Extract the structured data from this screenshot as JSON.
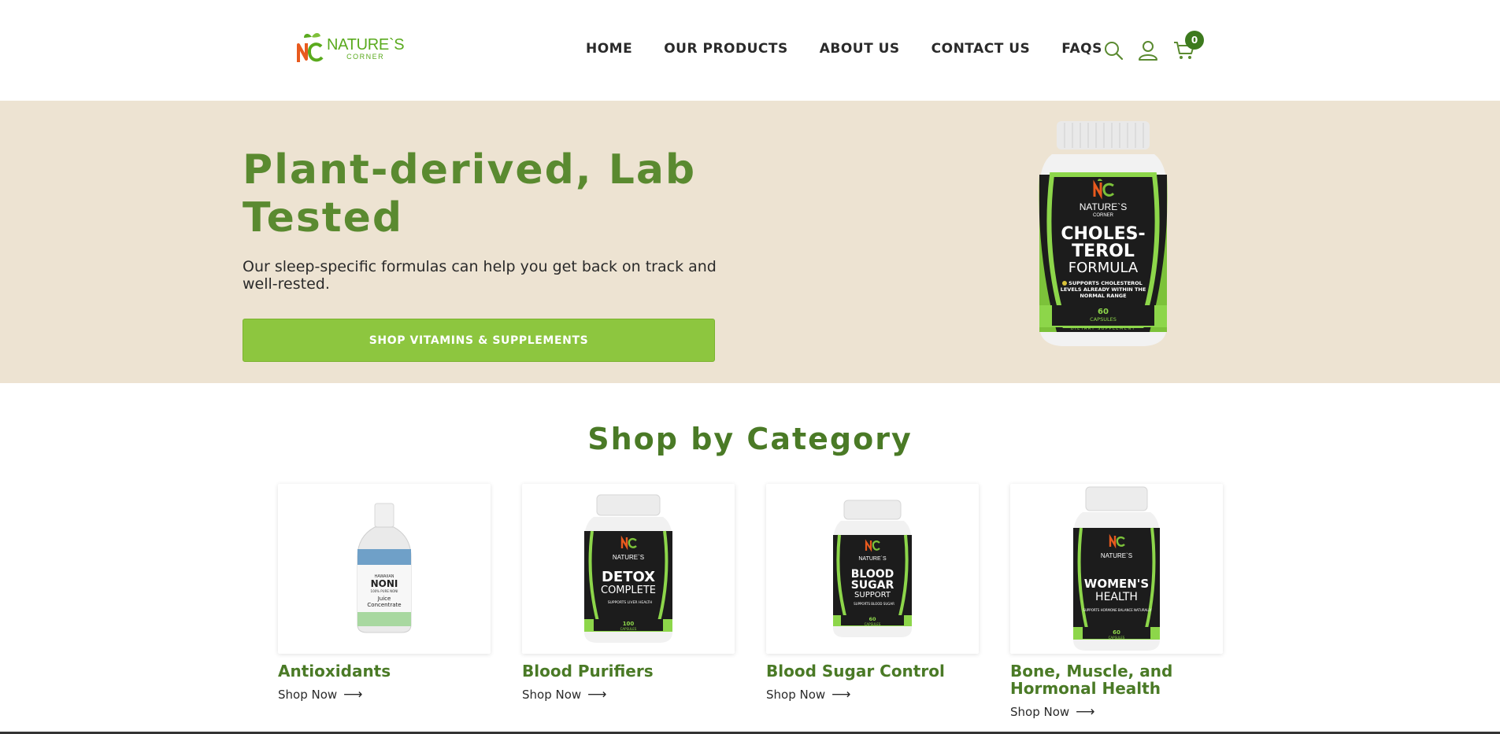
{
  "brand": {
    "name": "NATURE`S",
    "sub": "CORNER",
    "mark": "NC"
  },
  "nav": {
    "items": [
      {
        "label": "HOME"
      },
      {
        "label": "OUR PRODUCTS"
      },
      {
        "label": "ABOUT US"
      },
      {
        "label": "CONTACT US"
      },
      {
        "label": "FAQS"
      }
    ],
    "cart_count": "0"
  },
  "hero": {
    "title": "Plant-derived, Lab Tested",
    "subtitle": "Our sleep-specific formulas can help you get back on track and well-rested.",
    "button_label": "SHOP VITAMINS & SUPPLEMENTS",
    "bottle": {
      "brand": "NATURE`S",
      "brand_sub": "CORNER",
      "line1": "CHOLES-",
      "line2": "TEROL",
      "line3": "FORMULA",
      "claim1": "SUPPORTS CHOLESTEROL",
      "claim2": "LEVELS ALREADY WITHIN THE",
      "claim3": "NORMAL RANGE",
      "count": "60",
      "count_unit": "CAPSULES",
      "footer": "DIETARY SUPPLEMENT"
    }
  },
  "categories": {
    "title": "Shop by Category",
    "link_label": "Shop Now",
    "items": [
      {
        "name": "Antioxidants",
        "product": {
          "line1": "HAWAIIAN",
          "line2": "NONI",
          "line3": "100% PURE NONI",
          "line4": "Juice",
          "line5": "Concentrate"
        }
      },
      {
        "name": "Blood Purifiers",
        "product": {
          "line1": "DETOX",
          "line2": "COMPLETE",
          "claim": "SUPPORTS LIVER HEALTH",
          "count": "100",
          "count_unit": "CAPSULES"
        }
      },
      {
        "name": "Blood Sugar Control",
        "product": {
          "line1": "BLOOD",
          "line2": "SUGAR",
          "line3": "SUPPORT",
          "claim": "SUPPORTS BLOOD SUGAR",
          "count": "60",
          "count_unit": "CAPSULES"
        }
      },
      {
        "name": "Bone, Muscle, and Hormonal Health",
        "product": {
          "line1": "WOMEN'S",
          "line2": "HEALTH",
          "claim": "SUPPORTS HORMONE BALANCE NATURALLY",
          "count": "60",
          "count_unit": "CAPSULES"
        }
      }
    ]
  },
  "colors": {
    "accent_green": "#8dc63f",
    "dark_green": "#4a7a26",
    "hero_bg": "#ede3d2"
  }
}
